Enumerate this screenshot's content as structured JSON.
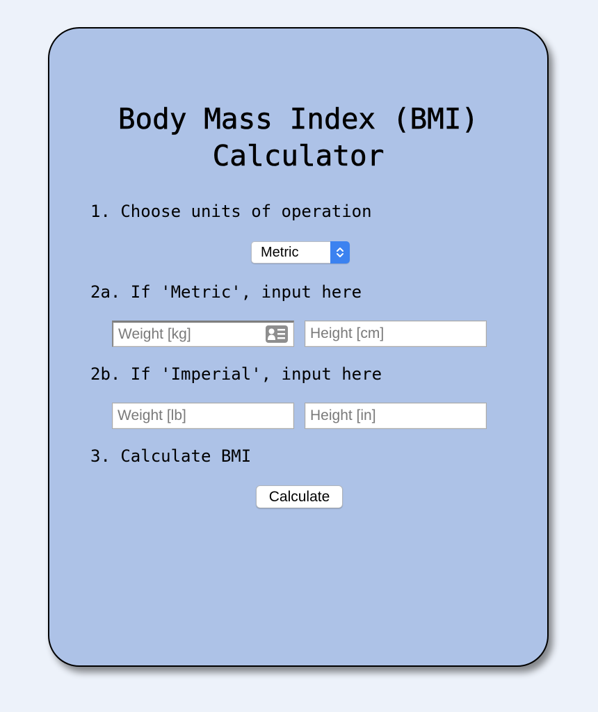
{
  "title_line1": "Body Mass Index (BMI)",
  "title_line2": "Calculator",
  "steps": {
    "step1": "1. Choose units of operation",
    "step2a": "2a. If 'Metric', input here",
    "step2b": "2b. If 'Imperial', input here",
    "step3": "3. Calculate BMI"
  },
  "units_select": {
    "value": "Metric",
    "icon": "chevron-up-down-icon"
  },
  "metric_inputs": {
    "weight_placeholder": "Weight [kg]",
    "height_placeholder": "Height [cm]",
    "weight_value": "",
    "height_value": "",
    "autofill_icon": "contact-card-icon"
  },
  "imperial_inputs": {
    "weight_placeholder": "Weight [lb]",
    "height_placeholder": "Height [in]",
    "weight_value": "",
    "height_value": ""
  },
  "calculate_button": "Calculate",
  "colors": {
    "page_background": "#edf2fa",
    "card_background": "#adc2e7",
    "select_accent": "#3c82f0"
  }
}
